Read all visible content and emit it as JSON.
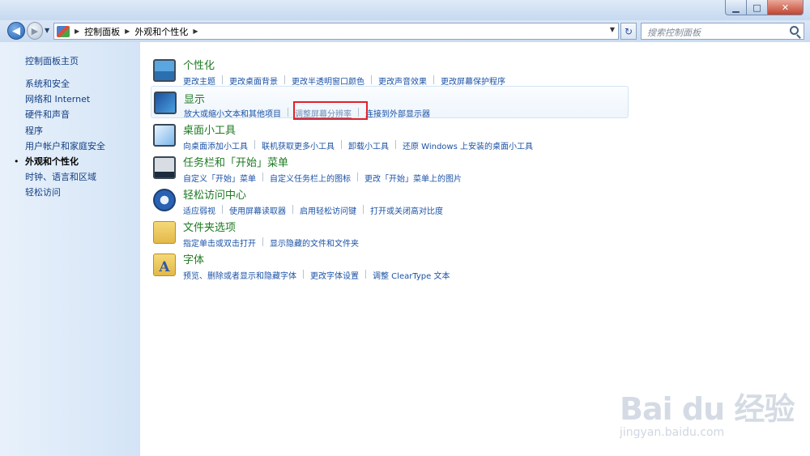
{
  "window": {
    "caption": {
      "minimize": "▁",
      "maximize": "□",
      "close": "✕"
    }
  },
  "nav": {
    "back_icon": "◀",
    "forward_icon": "▶",
    "history_icon": "▼",
    "breadcrumb": [
      "控制面板",
      "外观和个性化"
    ],
    "sep_icon": "▶",
    "dropdown_icon": "▼",
    "refresh_icon": "↻",
    "search_placeholder": "搜索控制面板"
  },
  "sidebar": {
    "home": "控制面板主页",
    "items": [
      {
        "label": "系统和安全"
      },
      {
        "label": "网络和 Internet"
      },
      {
        "label": "硬件和声音"
      },
      {
        "label": "程序"
      },
      {
        "label": "用户帐户和家庭安全"
      },
      {
        "label": "外观和个性化"
      },
      {
        "label": "时钟、语言和区域"
      },
      {
        "label": "轻松访问"
      }
    ]
  },
  "categories": [
    {
      "title": "个性化",
      "icon": "personalization-icon",
      "links": [
        "更改主题",
        "更改桌面背景",
        "更改半透明窗口颜色",
        "更改声音效果",
        "更改屏幕保护程序"
      ]
    },
    {
      "title": "显示",
      "icon": "display-icon",
      "links": [
        "放大或缩小文本和其他项目",
        "调整屏幕分辨率",
        "连接到外部显示器"
      ]
    },
    {
      "title": "桌面小工具",
      "icon": "gadgets-icon",
      "links": [
        "向桌面添加小工具",
        "联机获取更多小工具",
        "卸载小工具",
        "还原 Windows 上安装的桌面小工具"
      ]
    },
    {
      "title": "任务栏和「开始」菜单",
      "icon": "taskbar-icon",
      "links": [
        "自定义「开始」菜单",
        "自定义任务栏上的图标",
        "更改「开始」菜单上的图片"
      ]
    },
    {
      "title": "轻松访问中心",
      "icon": "ease-of-access-icon",
      "links": [
        "适应弱视",
        "使用屏幕读取器",
        "启用轻松访问键",
        "打开或关闭高对比度"
      ]
    },
    {
      "title": "文件夹选项",
      "icon": "folder-options-icon",
      "links": [
        "指定单击或双击打开",
        "显示隐藏的文件和文件夹"
      ]
    },
    {
      "title": "字体",
      "icon": "fonts-icon",
      "icon_glyph": "A",
      "links": [
        "预览、删除或者显示和隐藏字体",
        "更改字体设置",
        "调整 ClearType 文本"
      ]
    }
  ],
  "watermark": {
    "logo": "Bai du 经验",
    "url": "jingyan.baidu.com"
  }
}
